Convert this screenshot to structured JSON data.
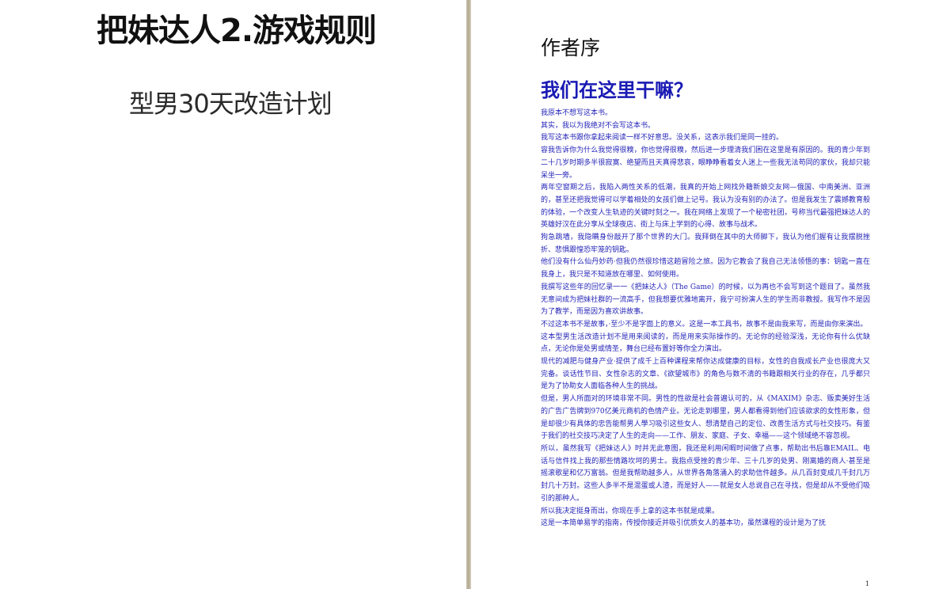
{
  "left_page": {
    "title": "把妹达人2.游戏规则",
    "subtitle": "型男30天改造计划"
  },
  "right_page": {
    "section_label": "作者序",
    "heading": "我们在这里干嘛？",
    "paragraphs": [
      "我原本不想写这本书。",
      "其实，我以为我绝对不会写这本书。",
      "我写这本书跟你拿起来阅读一样不好意思。没关系，这表示我们是同一挂的。",
      "容我告诉你为什么我觉得很糗，你也觉得很糗，然后进一步理清我们困在这里是有原因的。我的青少年到二十几岁时期多半很寂寞、绝望而且天真得悲哀，眼睁睁看着女人迷上一些我无法苟同的家伙，我却只能呆坐一旁。",
      "两年空窗期之后，我陷入两性关系的低潮，我真的开始上网找外籍新娘交友网—俄国、中南美洲、亚洲的，甚至还把我觉得可以学着相处的女孩们做上记号。我认为没有别的办法了。但是我发生了震撼教育般的体验，一个改变人生轨迹的关键时刻之一。我在网络上发现了一个秘密社团，号称当代最强把妹达人的英雄好汉在此分享从全球夜店、街上与床上学到的心得、故事与战术。",
      "狗急跳墙，我隐瞒身份敲开了那个世界的大门。我拜倒在其中的大师脚下，我认为他们握有让我摆脱挫折、悲惧跟惶恐牢笼的钥匙。",
      "他们没有什么仙丹妙药·但我仍然很珍惜这趟冒险之旅。因为它教会了我自己无法领悟的事：钥匙一直在我身上，我只是不知道放在哪里、如何使用。",
      "我撰写这些年的回忆录一一《把妹达人》（The Game）的时候，以为再也不会写到这个题目了。虽然我无意间成为把妹社群的一流高手，但我想要优雅地离开，我宁可扮演人生的学生而非教授。我写作不是因为了教学，而是因为喜欢讲故事。",
      "不过这本书不是故事，·至少不是字面上的意义。这是一本工具书，故事不是由我来写，而是由你来演出。",
      "这本型男生活改造计划不是用来阅读的，而是用来实际操作的。无论你的经验深浅，无论你有什么优缺点，无论你是处男或情圣，舞台已经布置好等你全力演出。",
      "现代的减肥与健身产业·提供了成千上百种课程来帮你达成健康的目标，女性的自我成长产业也很庞大又完备。谈话性节目、女性杂志的文章、《欲望城市》的角色与数不清的书籍跟相关行业的存在，几乎都只是为了协助女人面临各种人生的挑战。",
      "但是，男人所面对的环境非常不同。男性的性欲是社会普遍认可的，从《MAXIM》杂志、贩卖美好生活的广告广告牌到970亿美元商机的色情产业。无论走到哪里，男人都看得到他们应该欲求的女性形象，但是却很少有具体的忠告能帮男人學习吸引这些女人、想清楚自己的定位、改善生活方式与社交技巧。有鉴于我们的社交技巧决定了人生的走向——工作、朋友、家庭、子女、幸福——这个领域绝不容忽视。",
      "所以，虽然我写《把妹达人》时并无此意图，我还是利用闲暇时间做了点事，帮助出书后靠EMAIL、电话与信件找上我的那些情路坎坷的男士。我指点受挫的青少年、三十几岁的处男、刚离婚的商人·甚至是摇滚歌星和亿万富翁。但是我帮助越多人，从世界各角落涌入的求助信件越多。从几百封变成几千封几万封几十万封。这些人多半不是混蛋或人渣，而是好人——就是女人总说自己在寻找，但是却从不受他们吸引的那种人。",
      "所以我决定挺身而出，你现在手上拿的这本书就是成果。",
      "这是一本简单易学的指南，传授你接近并吸引优质女人的基本功，虽然课程的设计是为了抚"
    ],
    "page_number": "1"
  }
}
